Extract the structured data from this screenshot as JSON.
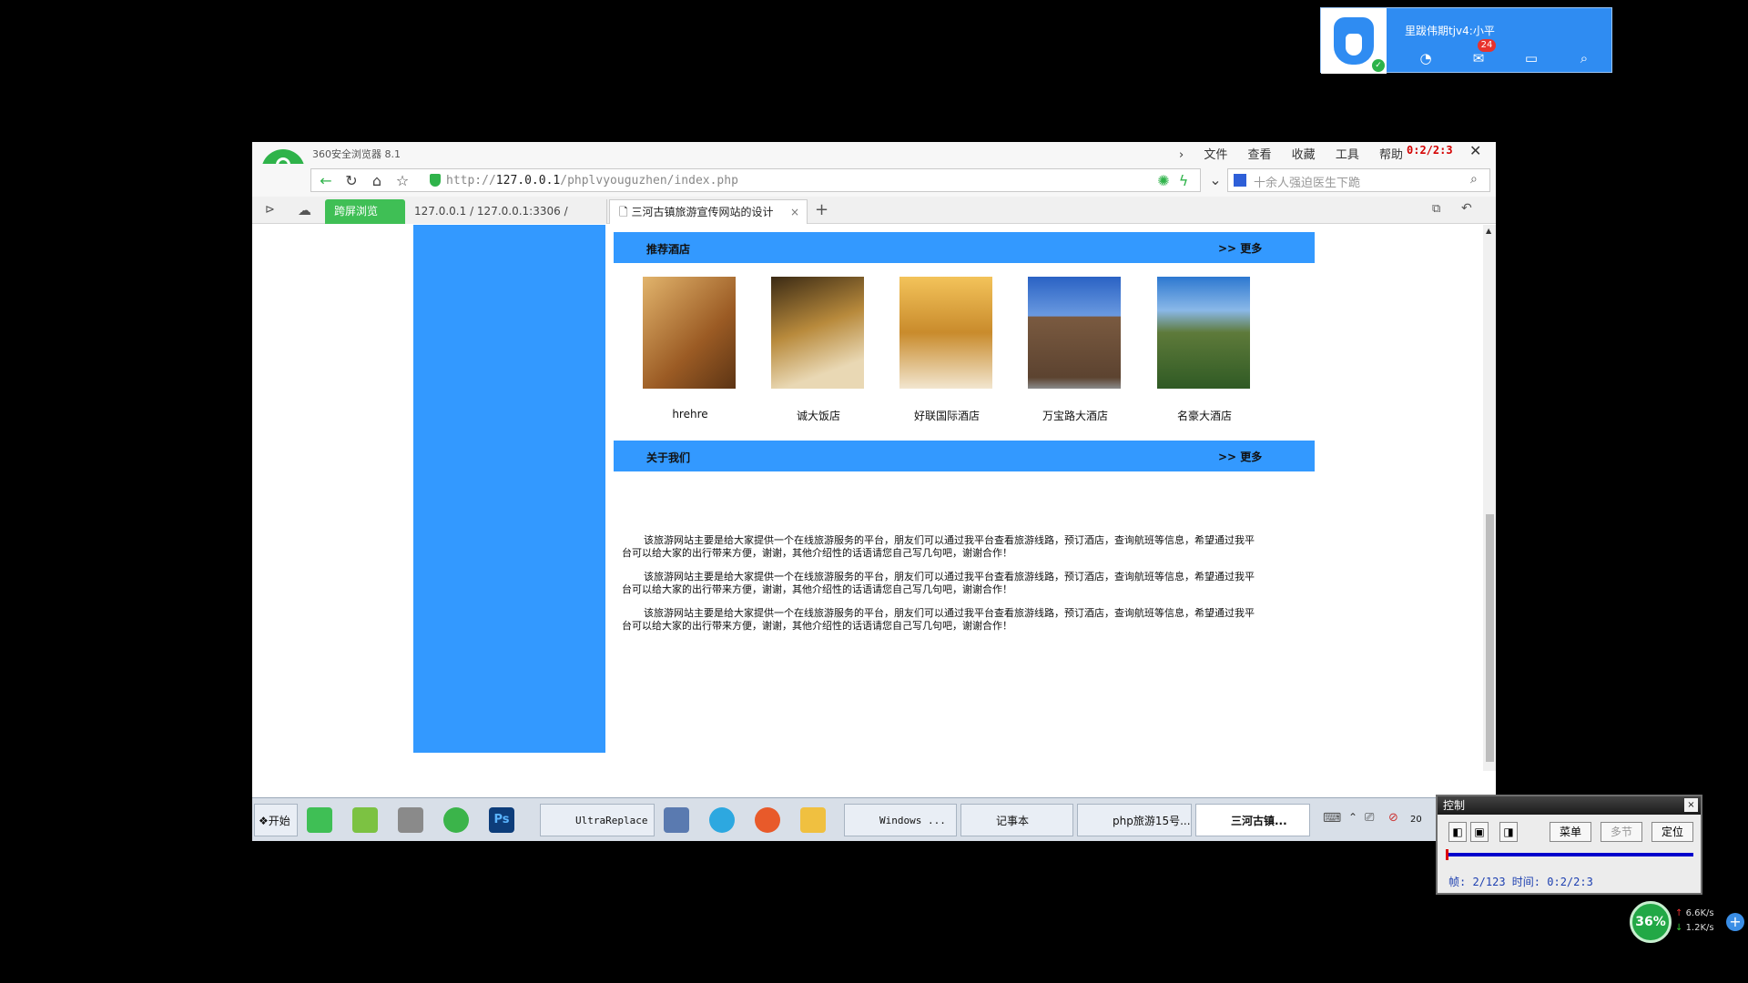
{
  "notification": {
    "title": "里跋伟期tjv4:小平",
    "mail_count": "24"
  },
  "browser": {
    "brand": "360安全浏览器 8.1",
    "menu": [
      "文件",
      "查看",
      "收藏",
      "工具",
      "帮助"
    ],
    "rec_time": "0:2/2:3",
    "url_prefix": "http://",
    "url_host": "127.0.0.1",
    "url_path": "/phplvyouguzhen/index.php",
    "search_placeholder": "十余人强迫医生下跪",
    "tabs": {
      "special": "跨屏浏览",
      "pma": "127.0.0.1 / 127.0.0.1:3306 /",
      "active": "三河古镇旅游宣传网站的设计"
    }
  },
  "page": {
    "hotels_section": {
      "title": "推荐酒店",
      "more": ">> 更多"
    },
    "hotels": [
      {
        "name": "hrehre",
        "palette": "#c8863a"
      },
      {
        "name": "诚大饭店",
        "palette": "#7a5a2a"
      },
      {
        "name": "好联国际酒店",
        "palette": "#d19a3c"
      },
      {
        "name": "万宝路大酒店",
        "palette": "#3d6fb8"
      },
      {
        "name": "名豪大酒店",
        "palette": "#3a7fc0"
      }
    ],
    "about_section": {
      "title": "关于我们",
      "more": ">> 更多"
    },
    "about_paragraphs": [
      "该旅游网站主要是给大家提供一个在线旅游服务的平台，朋友们可以通过我平台查看旅游线路，预订酒店，查询航班等信息，希望通过我平台可以给大家的出行带来方便，谢谢，其他介绍性的话语请您自己写几句吧，谢谢合作！",
      "该旅游网站主要是给大家提供一个在线旅游服务的平台，朋友们可以通过我平台查看旅游线路，预订酒店，查询航班等信息，希望通过我平台可以给大家的出行带来方便，谢谢，其他介绍性的话语请您自己写几句吧，谢谢合作！",
      "该旅游网站主要是给大家提供一个在线旅游服务的平台，朋友们可以通过我平台查看旅游线路，预订酒店，查询航班等信息，希望通过我平台可以给大家的出行带来方便，谢谢，其他介绍性的话语请您自己写几句吧，谢谢合作！"
    ],
    "accent_color": "#3399ff"
  },
  "taskbar": {
    "start": "开始",
    "ultrareplace": "UltraReplace",
    "windows": "Windows ...",
    "notepad": "记事本",
    "word": "php旅游15号...",
    "browser": "三河古镇...",
    "clock_partial": "20"
  },
  "control": {
    "title": "控制",
    "menu_btn": "菜单",
    "multi_btn": "多节",
    "locate_btn": "定位",
    "status": "帧: 2/123 时间: 0:2/2:3"
  },
  "net": {
    "percent": "36%",
    "up": "6.6K/s",
    "down": "1.2K/s"
  }
}
